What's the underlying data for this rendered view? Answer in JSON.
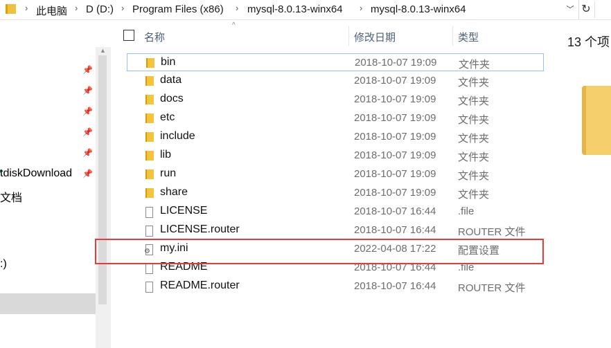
{
  "address_bar": {
    "crumbs": [
      "此电脑",
      "D (D:)",
      "Program Files (x86)",
      "mysql-8.0.13-winx64",
      "mysql-8.0.13-winx64"
    ],
    "dropdown_icon": "chevron-down-icon",
    "refresh_icon": "refresh-icon"
  },
  "nav": {
    "items": [
      "tdiskDownload",
      "文档",
      ":)"
    ],
    "pin_icon": "pin-icon"
  },
  "columns": {
    "name": "名称",
    "date": "修改日期",
    "type": "类型"
  },
  "files": [
    {
      "name": "bin",
      "date": "2018-10-07 19:09",
      "type": "文件夹",
      "icon": "folder-icon"
    },
    {
      "name": "data",
      "date": "2018-10-07 19:09",
      "type": "文件夹",
      "icon": "folder-icon"
    },
    {
      "name": "docs",
      "date": "2018-10-07 19:09",
      "type": "文件夹",
      "icon": "folder-icon"
    },
    {
      "name": "etc",
      "date": "2018-10-07 19:09",
      "type": "文件夹",
      "icon": "folder-icon"
    },
    {
      "name": "include",
      "date": "2018-10-07 19:09",
      "type": "文件夹",
      "icon": "folder-icon"
    },
    {
      "name": "lib",
      "date": "2018-10-07 19:09",
      "type": "文件夹",
      "icon": "folder-icon"
    },
    {
      "name": "run",
      "date": "2018-10-07 19:09",
      "type": "文件夹",
      "icon": "folder-icon"
    },
    {
      "name": "share",
      "date": "2018-10-07 19:09",
      "type": "文件夹",
      "icon": "folder-icon"
    },
    {
      "name": "LICENSE",
      "date": "2018-10-07 16:44",
      "type": ".file",
      "icon": "file-icon"
    },
    {
      "name": "LICENSE.router",
      "date": "2018-10-07 16:44",
      "type": "ROUTER 文件",
      "icon": "file-icon"
    },
    {
      "name": "my.ini",
      "date": "2022-04-08 17:22",
      "type": "配置设置",
      "icon": "settings-file-icon"
    },
    {
      "name": "README",
      "date": "2018-10-07 16:44",
      "type": ".file",
      "icon": "file-icon"
    },
    {
      "name": "README.router",
      "date": "2018-10-07 16:44",
      "type": "ROUTER 文件",
      "icon": "file-icon"
    }
  ],
  "details": {
    "count": "13 个项"
  },
  "colors": {
    "highlight": "#e8393b",
    "folder": "#f3c43e",
    "header_text": "#4c607a"
  }
}
